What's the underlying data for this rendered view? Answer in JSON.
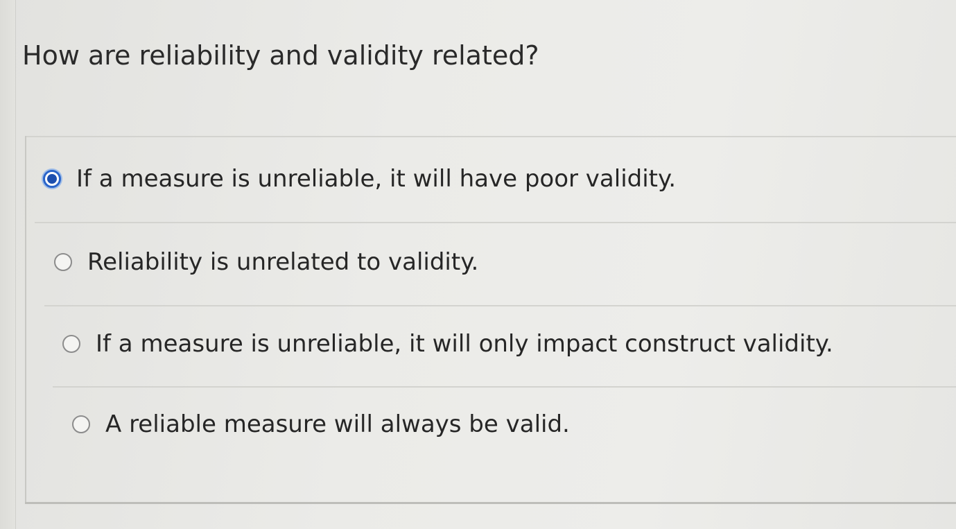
{
  "question": {
    "text": "How are reliability and validity related?"
  },
  "options": [
    {
      "label": "If a measure is unreliable, it will have poor validity.",
      "selected": true
    },
    {
      "label": "Reliability is unrelated to validity.",
      "selected": false
    },
    {
      "label": "If a measure is unreliable, it will only impact construct validity.",
      "selected": false
    },
    {
      "label": "A reliable measure will always be valid.",
      "selected": false
    }
  ],
  "colors": {
    "selected_radio": "#1d4fae",
    "text": "#262626"
  },
  "icons": {
    "selected": "radio-selected-icon",
    "unselected": "radio-unselected-icon"
  }
}
